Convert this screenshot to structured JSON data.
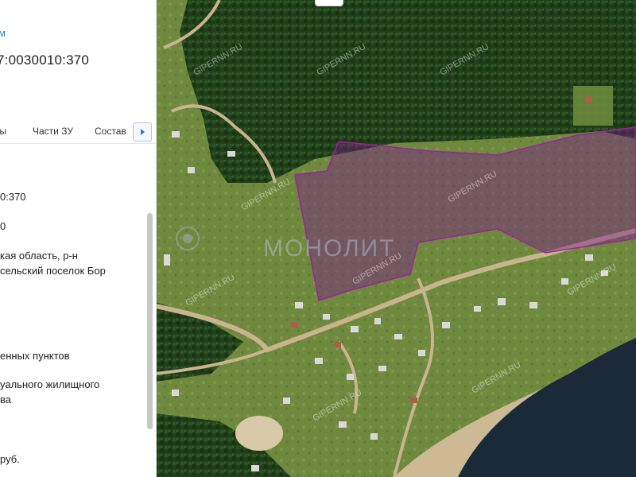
{
  "panel": {
    "link_text": "м",
    "cadastral_number": "7:0030010:370",
    "tabs": [
      {
        "label": "ты"
      },
      {
        "label": "Части ЗУ"
      },
      {
        "label": "Состав"
      }
    ],
    "lines": [
      "0:370",
      "0",
      "кая область, р-н",
      "сельский поселок Бор",
      "енных пунктов",
      "уального жилищного",
      "ва",
      "руб."
    ]
  },
  "map": {
    "watermarks": [
      "GIPERNN.RU",
      "GIPERNN.RU",
      "GIPERNN.RU",
      "GIPERNN.RU",
      "GIPERNN.RU",
      "GIPERNN.RU",
      "GIPERNN.RU",
      "GIPERNN.RU",
      "GIPERNN.RU",
      "GIPERNN.RU"
    ],
    "logo_text": "МОНОЛИТ",
    "parcel_color": "#a020a0",
    "water_color": "#1a2a38",
    "forest_color": "#1f3d18"
  }
}
